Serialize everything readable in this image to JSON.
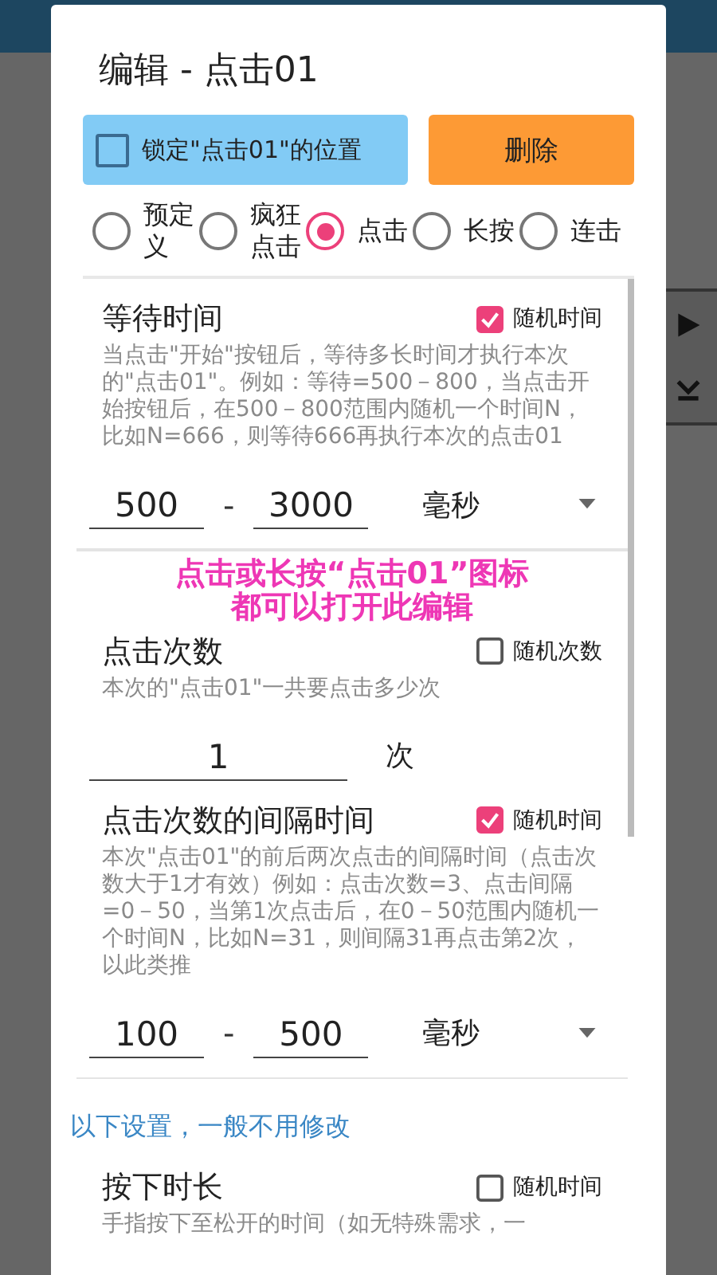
{
  "dialog": {
    "title": "编辑 - 点击01",
    "lock": {
      "label": "锁定\"点击01\"的位置",
      "checked": false
    },
    "delete_button": "删除",
    "modes": [
      {
        "label": "预定义",
        "selected": false
      },
      {
        "label": "疯狂点击",
        "selected": false
      },
      {
        "label": "点击",
        "selected": true
      },
      {
        "label": "长按",
        "selected": false
      },
      {
        "label": "连击",
        "selected": false
      }
    ],
    "sections": [
      {
        "kind": "range",
        "title": "等待时间",
        "random": {
          "label": "随机时间",
          "checked": true
        },
        "description": "当点击\"开始\"按钮后，等待多长时间才执行本次的\"点击01\"。例如：等待=500－800，当点击开始按钮后，在500－800范围内随机一个时间N，比如N=666，则等待666再执行本次的点击01",
        "from": "500",
        "separator": "-",
        "to": "3000",
        "unit": "毫秒"
      },
      {
        "kind": "count",
        "title": "点击次数",
        "random": {
          "label": "随机次数",
          "checked": false
        },
        "description": "本次的\"点击01\"一共要点击多少次",
        "value": "1",
        "unit": "次"
      },
      {
        "kind": "range",
        "title": "点击次数的间隔时间",
        "random": {
          "label": "随机时间",
          "checked": true
        },
        "description": "本次\"点击01\"的前后两次点击的间隔时间（点击次数大于1才有效）例如：点击次数=3、点击间隔=0－50，当第1次点击后，在0－50范围内随机一个时间N，比如N=31，则间隔31再点击第2次，以此类推",
        "from": "100",
        "separator": "-",
        "to": "500",
        "unit": "毫秒"
      }
    ],
    "note": "以下设置，一般不用修改",
    "more_sections": [
      {
        "kind": "header",
        "title": "按下时长",
        "random": {
          "label": "随机时间",
          "checked": false
        },
        "description": "手指按下至松开的时间（如无特殊需求，一"
      }
    ]
  },
  "tip": [
    "点击或长按“点击01”图标",
    "都可以打开此编辑"
  ]
}
